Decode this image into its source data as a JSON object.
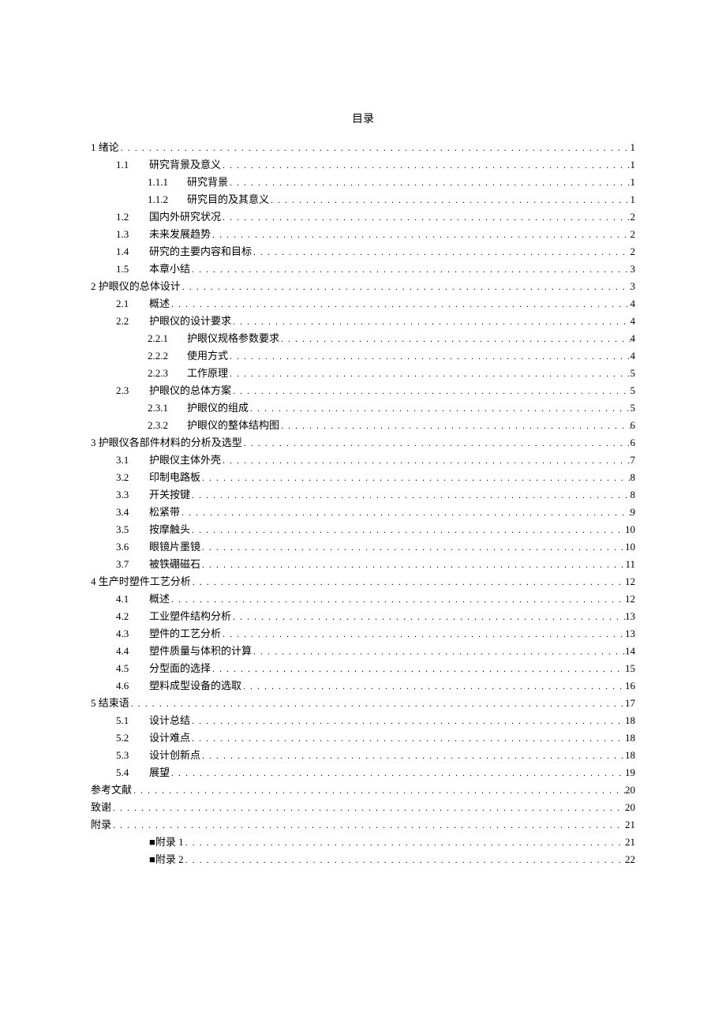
{
  "title": "目录",
  "entries": [
    {
      "level": 0,
      "num": "1",
      "label": "绪论",
      "page": "1"
    },
    {
      "level": 1,
      "num": "1.1",
      "label": "研究背景及意义",
      "page": "1"
    },
    {
      "level": 2,
      "num": "1.1.1",
      "label": "研究背景",
      "page": "1"
    },
    {
      "level": 2,
      "num": "1.1.2",
      "label": "研究目的及其意义",
      "page": "1"
    },
    {
      "level": 1,
      "num": "1.2",
      "label": "国内外研究状况",
      "page": "2"
    },
    {
      "level": 1,
      "num": "1.3",
      "label": "未来发展趋势",
      "page": "2"
    },
    {
      "level": 1,
      "num": "1.4",
      "label": "研究的主要内容和目标",
      "page": "2"
    },
    {
      "level": 1,
      "num": "1.5",
      "label": "本章小结",
      "page": "3"
    },
    {
      "level": 0,
      "num": "2",
      "label": "护眼仪的总体设计",
      "page": "3"
    },
    {
      "level": 1,
      "num": "2.1",
      "label": "概述",
      "page": "4"
    },
    {
      "level": 1,
      "num": "2.2",
      "label": "护眼仪的设计要求",
      "page": "4"
    },
    {
      "level": 2,
      "num": "2.2.1",
      "label": "护眼仪规格参数要求",
      "page": "4"
    },
    {
      "level": 2,
      "num": "2.2.2",
      "label": "使用方式",
      "page": "4"
    },
    {
      "level": 2,
      "num": "2.2.3",
      "label": "工作原理",
      "page": "5"
    },
    {
      "level": 1,
      "num": "2.3",
      "label": "护眼仪的总体方案",
      "page": "5"
    },
    {
      "level": 2,
      "num": "2.3.1",
      "label": "护眼仪的组成",
      "page": "5"
    },
    {
      "level": 2,
      "num": "2.3.2",
      "label": "护眼仪的整体结构图",
      "page": "6"
    },
    {
      "level": 0,
      "num": "3",
      "label": "护眼仪各部件材料的分析及选型",
      "page": "6"
    },
    {
      "level": 1,
      "num": "3.1",
      "label": "护眼仪主体外壳",
      "page": "7"
    },
    {
      "level": 1,
      "num": "3.2",
      "label": "印制电路板",
      "page": "8"
    },
    {
      "level": 1,
      "num": "3.3",
      "label": "开关按键",
      "page": "8"
    },
    {
      "level": 1,
      "num": "3.4",
      "label": "松紧带",
      "page": "9"
    },
    {
      "level": 1,
      "num": "3.5",
      "label": "按摩触头",
      "page": "10"
    },
    {
      "level": 1,
      "num": "3.6",
      "label": "眼镜片墨镜",
      "page": "10"
    },
    {
      "level": 1,
      "num": "3.7",
      "label": "被铁硼磁石",
      "page": "11"
    },
    {
      "level": 0,
      "num": "4",
      "label": "生产时塑件工艺分析",
      "page": "12"
    },
    {
      "level": 1,
      "num": "4.1",
      "label": "概述",
      "page": "12"
    },
    {
      "level": 1,
      "num": "4.2",
      "label": "工业塑件结构分析",
      "page": "13"
    },
    {
      "level": 1,
      "num": "4.3",
      "label": "塑件的工艺分析",
      "page": "13"
    },
    {
      "level": 1,
      "num": "4.4",
      "label": "塑件质量与体积的计算",
      "page": "14"
    },
    {
      "level": 1,
      "num": "4.5",
      "label": "分型面的选择",
      "page": "15"
    },
    {
      "level": 1,
      "num": "4.6",
      "label": "塑料成型设备的选取",
      "page": "16"
    },
    {
      "level": 0,
      "num": "5",
      "label": "结束语",
      "page": "17"
    },
    {
      "level": 1,
      "num": "5.1",
      "label": "设计总结",
      "page": "18"
    },
    {
      "level": 1,
      "num": "5.2",
      "label": "设计难点",
      "page": "18"
    },
    {
      "level": 1,
      "num": "5.3",
      "label": "设计创新点",
      "page": "18"
    },
    {
      "level": 1,
      "num": "5.4",
      "label": "展望",
      "page": "19"
    },
    {
      "level": 0,
      "num": "",
      "label": "参考文献",
      "page": "20"
    },
    {
      "level": 0,
      "num": "",
      "label": "致谢",
      "page": "20"
    },
    {
      "level": 0,
      "num": "",
      "label": "附录",
      "page": "21"
    },
    {
      "level": 1,
      "num": "",
      "label": "■附录 1",
      "page": "21"
    },
    {
      "level": 1,
      "num": "",
      "label": "■附录 2",
      "page": "22"
    }
  ]
}
